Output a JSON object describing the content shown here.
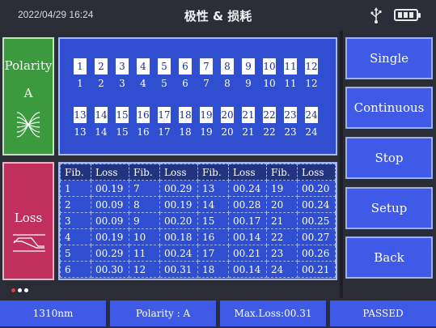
{
  "header": {
    "datetime": "2022/04/29  16:24",
    "title": "极性 & 损耗",
    "usb_icon": "usb-icon",
    "battery_icon": "battery-icon"
  },
  "polarity_tile": {
    "label": "Polarity",
    "value": "A",
    "icon": "polarity-cross-icon",
    "color": "#3b9a3d"
  },
  "loss_tile": {
    "label": "Loss",
    "icon": "loss-graph-icon",
    "color": "#c02f5d"
  },
  "fibers": [
    "1",
    "2",
    "3",
    "4",
    "5",
    "6",
    "7",
    "8",
    "9",
    "10",
    "11",
    "12",
    "13",
    "14",
    "15",
    "16",
    "17",
    "18",
    "19",
    "20",
    "21",
    "22",
    "23",
    "24"
  ],
  "loss_table": {
    "headers": [
      "Fib.",
      "Loss",
      "Fib.",
      "Loss",
      "Fib.",
      "Loss",
      "Fib.",
      "Loss"
    ],
    "rows": [
      [
        "1",
        "00.19",
        "7",
        "00.29",
        "13",
        "00.24",
        "19",
        "00.20"
      ],
      [
        "2",
        "00.09",
        "8",
        "00.19",
        "14",
        "00.28",
        "20",
        "00.24"
      ],
      [
        "3",
        "00.09",
        "9",
        "00.20",
        "15",
        "00.17",
        "21",
        "00.25"
      ],
      [
        "4",
        "00.19",
        "10",
        "00.18",
        "16",
        "00.14",
        "22",
        "00.27"
      ],
      [
        "5",
        "00.29",
        "11",
        "00.24",
        "17",
        "00.21",
        "23",
        "00.26"
      ],
      [
        "6",
        "00.30",
        "12",
        "00.31",
        "18",
        "00.14",
        "24",
        "00.21"
      ]
    ]
  },
  "buttons": {
    "single": "Single",
    "continuous": "Continuous",
    "stop": "Stop",
    "setup": "Setup",
    "back": "Back"
  },
  "page_indicator": {
    "pages": 3,
    "active": 0,
    "active_color": "#e23b3b",
    "inactive_color": "#ffffff"
  },
  "status_bar": {
    "wavelength": "1310nm",
    "polarity": "Polarity : A",
    "max_loss": "Max.Loss:00.31",
    "result": "PASSED"
  },
  "colors": {
    "accent_blue": "#3e5ae6",
    "panel_blue": "#2f4fd0"
  }
}
